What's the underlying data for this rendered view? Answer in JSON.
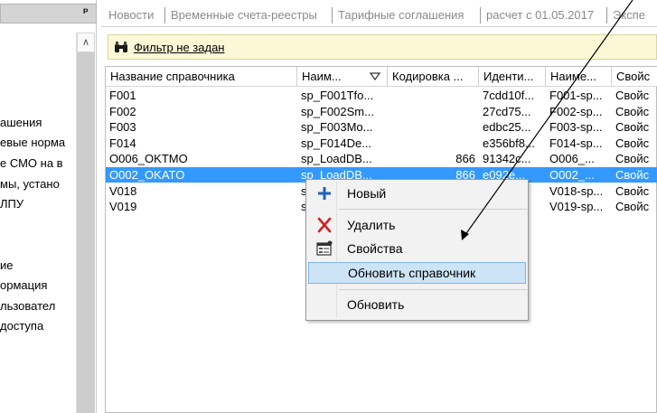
{
  "left_panel": {
    "pin_icon": "pin-icon",
    "tree_items": [
      "ашения",
      "евые норма",
      "е СМО на в",
      "мы, устано",
      " ЛПУ",
      "ие",
      "ормация",
      "льзовател",
      " доступа"
    ]
  },
  "tabs": [
    "Новости",
    "Временные счета-реестры",
    "Тарифные соглашения",
    "расчет с 01.05.2017",
    "Экспе"
  ],
  "filter": {
    "icon": "binoculars-icon",
    "text": "Фильтр не задан"
  },
  "grid": {
    "columns": [
      "Название справочника",
      "Наим...",
      "Кодировка ...",
      "Иденти...",
      "Наиме...",
      "Свойс"
    ],
    "rows": [
      [
        "F001",
        "sp_F001Tfo...",
        "",
        "7cdd10f...",
        "F001-sp...",
        "Свойс"
      ],
      [
        "F002",
        "sp_F002Sm...",
        "",
        "27cd75...",
        "F002-sp...",
        "Свойс"
      ],
      [
        "F003",
        "sp_F003Mo...",
        "",
        "edbc25...",
        "F003-sp...",
        "Свойс"
      ],
      [
        "F014",
        "sp_F014De...",
        "",
        "e356bf8...",
        "F014-sp...",
        "Свойс"
      ],
      [
        "O006_OKTMO",
        "sp_LoadDB...",
        "866",
        "91342c...",
        "O006_...",
        "Свойс"
      ],
      [
        "O002_OKATO",
        "sp_LoadDB...",
        "866",
        "e092e...",
        "O002_...",
        "Свойс"
      ],
      [
        "V018",
        "sp",
        "",
        "",
        "V018-sp...",
        "Свойс"
      ],
      [
        "V019",
        "sp",
        "",
        "",
        "V019-sp...",
        "Свойс"
      ]
    ],
    "selected_row": 5
  },
  "context_menu": {
    "items": [
      {
        "label": "Новый",
        "icon": "plus-icon"
      },
      {
        "label": "Удалить",
        "icon": "delete-x-icon"
      },
      {
        "label": "Свойства",
        "icon": "properties-icon"
      },
      {
        "label": "Обновить справочник",
        "icon": ""
      },
      {
        "label": "Обновить",
        "icon": ""
      }
    ],
    "highlighted_index": 3
  },
  "colors": {
    "selection": "#3399ff",
    "filter_bg": "#fcf8d6",
    "menu_hover": "#cde4f7",
    "plus_icon": "#1f5fbf",
    "delete_icon": "#d42020"
  }
}
